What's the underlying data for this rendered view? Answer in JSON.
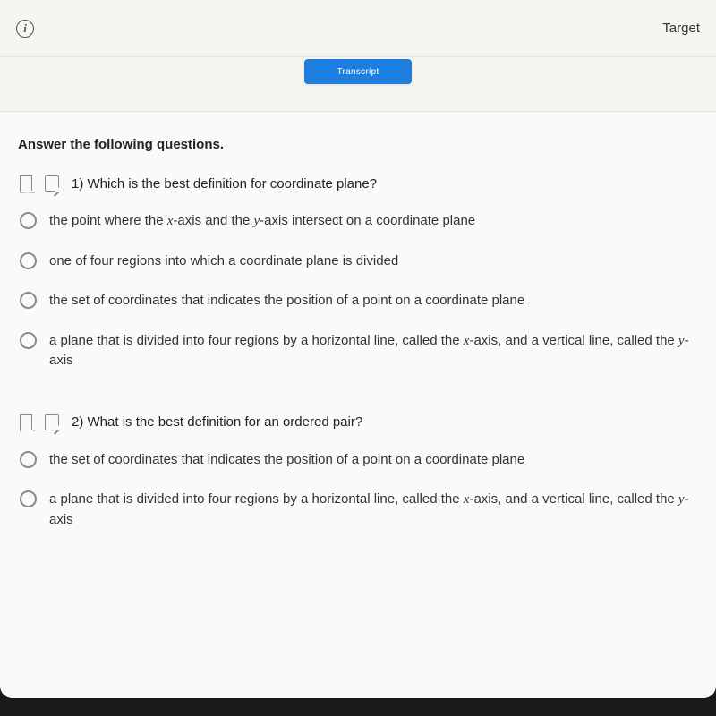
{
  "topbar": {
    "info_glyph": "i",
    "target_label": "Target"
  },
  "subbar": {
    "button_label": "Transcript"
  },
  "quiz": {
    "heading": "Answer the following questions.",
    "q1": {
      "number": "1)",
      "prompt": "Which is the best definition for coordinate plane?",
      "options": [
        {
          "pre": "the point where the ",
          "v1": "x",
          "mid": "-axis and the ",
          "v2": "y",
          "post": "-axis intersect on a coordinate plane"
        },
        {
          "pre": "one of four regions into which a coordinate plane is divided",
          "v1": "",
          "mid": "",
          "v2": "",
          "post": ""
        },
        {
          "pre": "the set of coordinates that indicates the position of a point on a coordinate plane",
          "v1": "",
          "mid": "",
          "v2": "",
          "post": ""
        },
        {
          "pre": "a plane that is divided into four regions by a horizontal line, called the ",
          "v1": "x",
          "mid": "-axis, and a vertical line, called the ",
          "v2": "y",
          "post": "-axis"
        }
      ]
    },
    "q2": {
      "number": "2)",
      "prompt": "What is the best definition for an ordered pair?",
      "options": [
        {
          "pre": "the set of coordinates that indicates the position of a point on a coordinate plane",
          "v1": "",
          "mid": "",
          "v2": "",
          "post": ""
        },
        {
          "pre": "a plane that is divided into four regions by a horizontal line, called the ",
          "v1": "x",
          "mid": "-axis, and a vertical line, called the ",
          "v2": "y",
          "post": "-axis"
        }
      ]
    }
  }
}
